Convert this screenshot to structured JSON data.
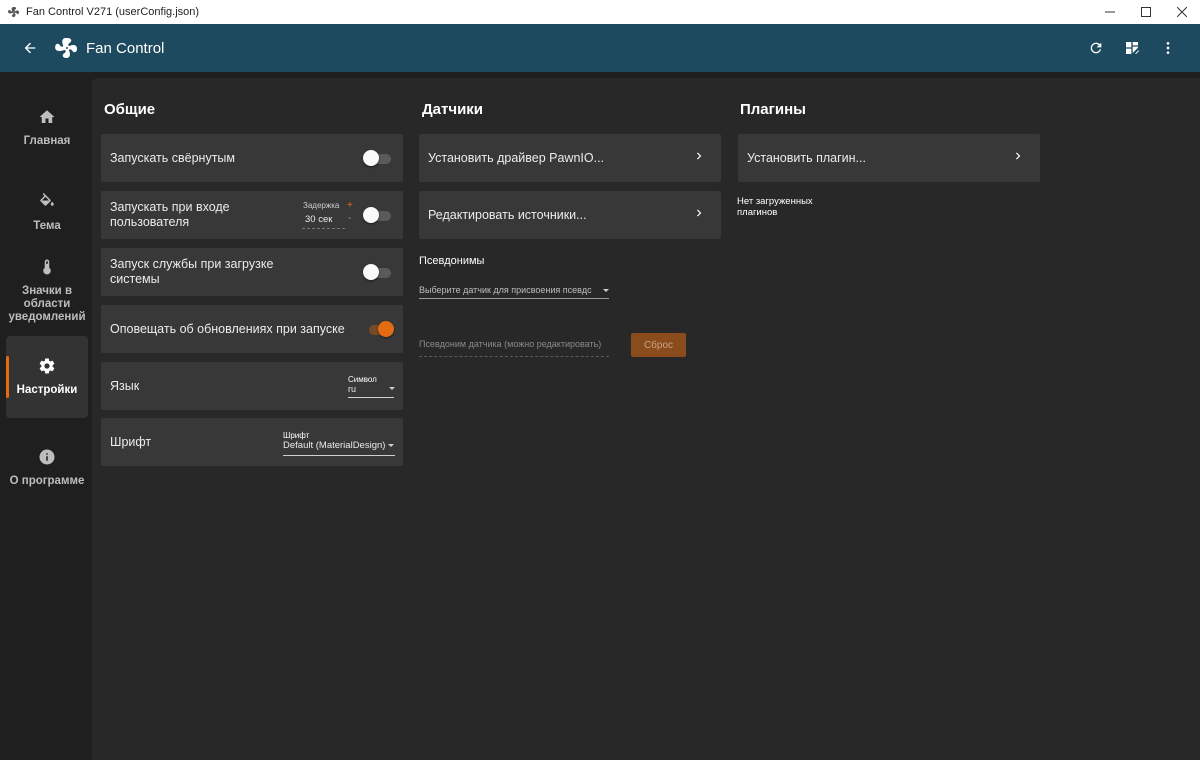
{
  "window": {
    "title": "Fan Control V271 (userConfig.json)",
    "controls": [
      "minimize-icon",
      "maximize-icon",
      "close-icon"
    ]
  },
  "appbar": {
    "title": "Fan Control",
    "back_icon": "arrow-left-icon",
    "logo_icon": "fan-icon",
    "actions": [
      "refresh-icon",
      "dashboard-edit-icon",
      "more-vert-icon"
    ],
    "color": "#1e4a5f"
  },
  "nav": {
    "items": [
      {
        "label": "Главная",
        "icon": "home-icon"
      },
      {
        "label": "Тема",
        "icon": "paint-bucket-icon"
      },
      {
        "label": "Значки в области уведомлений",
        "icon": "thermometer-icon"
      },
      {
        "label": "Настройки",
        "icon": "gear-icon",
        "active": true
      },
      {
        "label": "О программе",
        "icon": "info-icon"
      }
    ],
    "accent": "#e36b12"
  },
  "general": {
    "title": "Общие",
    "start_minimized": {
      "label": "Запускать свёрнутым",
      "enabled": false
    },
    "start_login": {
      "label": "Запускать при входе пользователя",
      "delay_label": "Задержка",
      "delay_value": "30 сек",
      "plus": "+",
      "minus": "-",
      "enabled": false
    },
    "start_service": {
      "label": "Запуск службы при загрузке системы",
      "enabled": false
    },
    "check_updates": {
      "label": "Оповещать об обновлениях при запуске",
      "enabled": true
    },
    "language": {
      "label": "Язык",
      "field_label": "Символ",
      "value": "ru"
    },
    "font": {
      "label": "Шрифт",
      "field_label": "Шрифт",
      "value": "Default (MaterialDesign)"
    }
  },
  "sensors": {
    "title": "Датчики",
    "install_driver": "Установить драйвер PawnIO...",
    "edit_sources": "Редактировать источники...",
    "aliases_label": "Псевдонимы",
    "select_placeholder": "Выберите датчик для присвоения псевдс",
    "alias_placeholder": "Псевдоним датчика (можно редактировать)",
    "reset_label": "Сброс"
  },
  "plugins": {
    "title": "Плагины",
    "install_plugin": "Установить плагин...",
    "no_plugins_line1": "Нет загруженных",
    "no_plugins_line2": "плагинов"
  }
}
